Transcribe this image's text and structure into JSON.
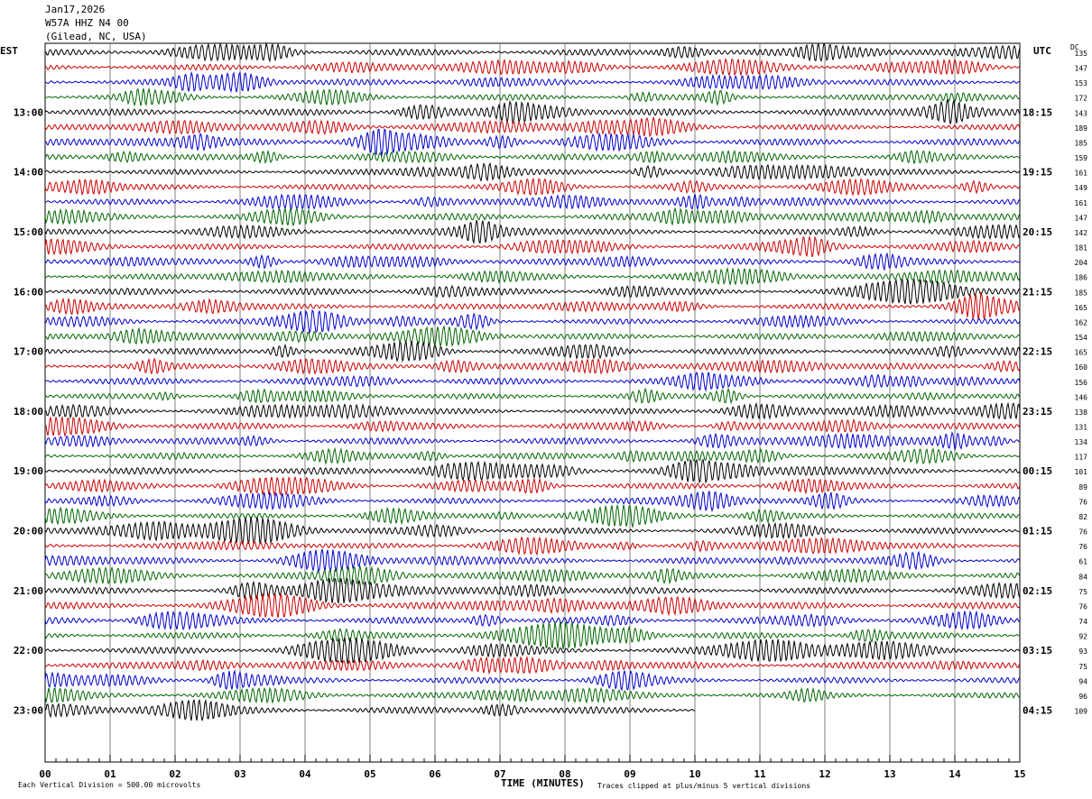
{
  "header": {
    "date": "Jan17,2026",
    "channel": "W57A HHZ N4 00",
    "location": "(Gilead, NC, USA)"
  },
  "left_tz": "EST",
  "right_tz": "UTC",
  "dc_label": "DC",
  "footer": {
    "scale_note": "Each Vertical Division =  500.00 microvolts",
    "x_axis_title": "TIME (MINUTES)",
    "clip_note": "Traces clipped at plus/minus 5 vertical divisions"
  },
  "trace_colors": [
    "#000000",
    "#cc0000",
    "#0000cc",
    "#006600"
  ],
  "chart_data": {
    "type": "line",
    "title": "",
    "xlabel": "TIME (MINUTES)",
    "ylabel": "",
    "xlim": [
      0,
      15
    ],
    "x_ticks": [
      "00",
      "01",
      "02",
      "03",
      "04",
      "05",
      "06",
      "07",
      "08",
      "09",
      "10",
      "11",
      "12",
      "13",
      "14",
      "15"
    ],
    "grid": true,
    "rows_per_hour": 4,
    "left_hour_labels": [
      "13:00",
      "14:00",
      "15:00",
      "16:00",
      "17:00",
      "18:00",
      "19:00",
      "20:00",
      "21:00",
      "22:00",
      "23:00"
    ],
    "right_hour_labels": [
      "18:15",
      "19:15",
      "20:15",
      "21:15",
      "22:15",
      "23:15",
      "00:15",
      "01:15",
      "02:15",
      "03:15",
      "04:15"
    ],
    "dc_offsets": [
      135,
      147,
      153,
      172,
      143,
      189,
      185,
      159,
      161,
      149,
      161,
      147,
      142,
      181,
      204,
      186,
      185,
      165,
      162,
      154,
      165,
      160,
      156,
      146,
      138,
      131,
      134,
      117,
      101,
      89,
      76,
      82,
      76,
      76,
      61,
      84,
      75,
      76,
      74,
      92,
      93,
      75,
      94,
      96,
      109
    ],
    "last_trace_minutes": 10
  }
}
